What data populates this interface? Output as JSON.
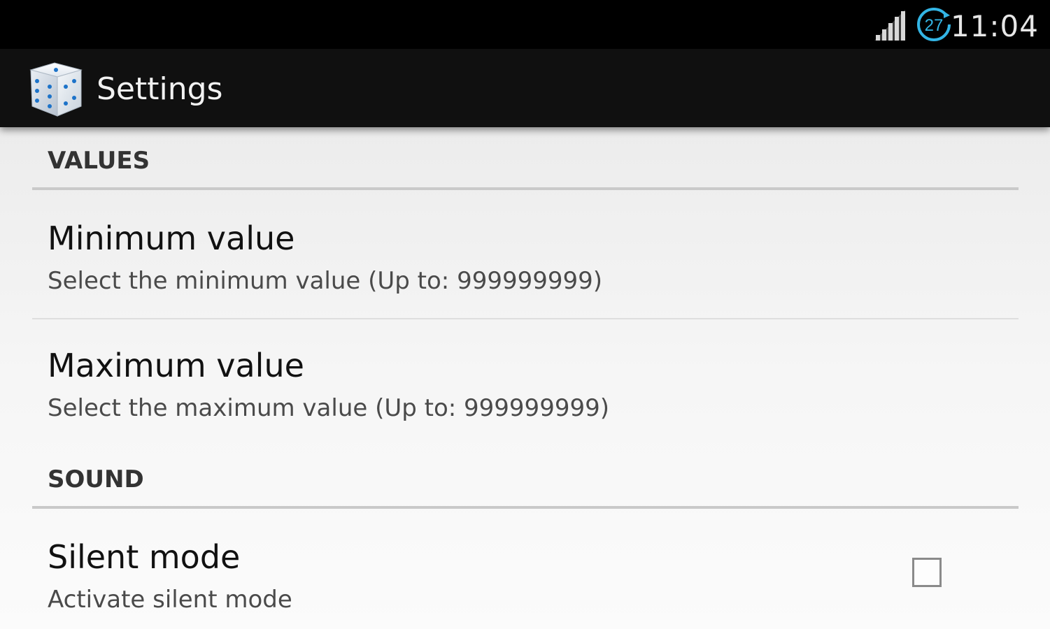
{
  "status_bar": {
    "time": "11:04",
    "notification_badge": "27",
    "icons": [
      "signal-icon",
      "sync-notification-icon"
    ]
  },
  "action_bar": {
    "title": "Settings",
    "icon": "dice-icon"
  },
  "preferences": {
    "values_category": "VALUES",
    "minimum_title": "Minimum value",
    "minimum_summary": "Select the minimum value (Up to: 999999999)",
    "maximum_title": "Maximum value",
    "maximum_summary": "Select the maximum value (Up to: 999999999)",
    "sound_category": "SOUND",
    "silent_title": "Silent mode",
    "silent_summary": "Activate silent mode",
    "silent_checked": false
  },
  "colors": {
    "status_bar": "#000000",
    "action_bar": "#101010",
    "content_background": "#f2f2f2",
    "accent": "#33b5e5"
  }
}
